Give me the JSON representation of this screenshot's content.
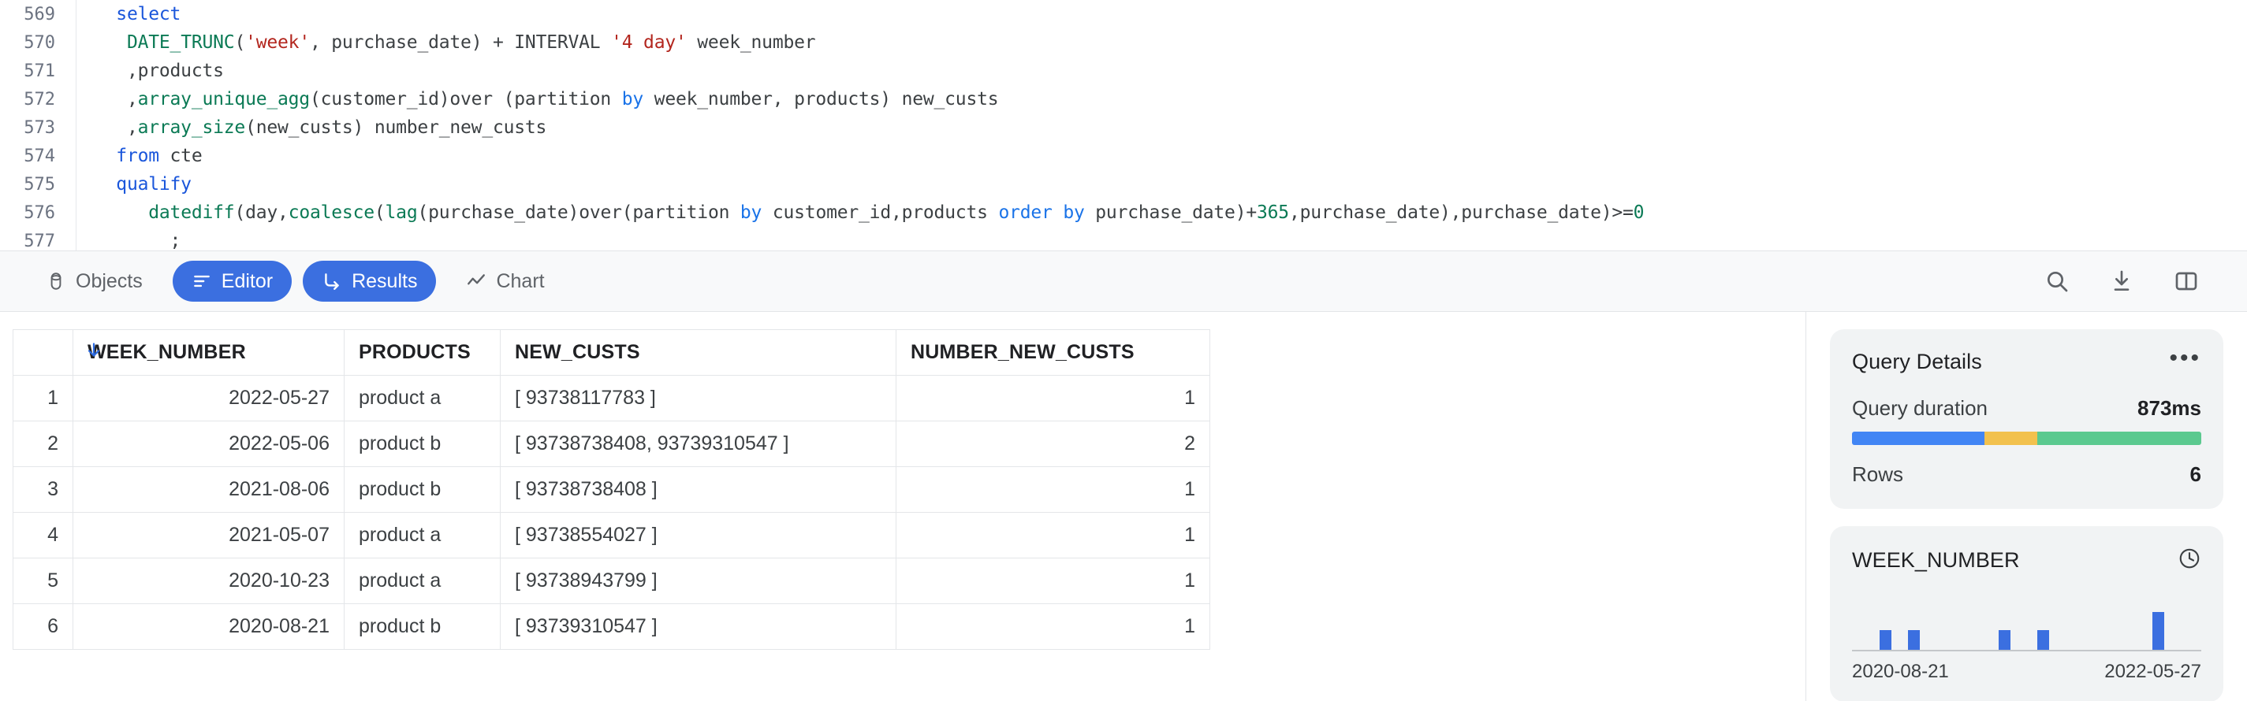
{
  "editor": {
    "lines": [
      {
        "number": "569",
        "tokens": [
          {
            "t": "  ",
            "c": ""
          },
          {
            "t": "select",
            "c": "kw"
          }
        ]
      },
      {
        "number": "570",
        "tokens": [
          {
            "t": "   ",
            "c": ""
          },
          {
            "t": "DATE_TRUNC",
            "c": "fn"
          },
          {
            "t": "(",
            "c": ""
          },
          {
            "t": "'week'",
            "c": "str"
          },
          {
            "t": ", purchase_date) + INTERVAL ",
            "c": ""
          },
          {
            "t": "'4 day'",
            "c": "str"
          },
          {
            "t": " week_number",
            "c": ""
          }
        ]
      },
      {
        "number": "571",
        "tokens": [
          {
            "t": "   ,products",
            "c": ""
          }
        ]
      },
      {
        "number": "572",
        "tokens": [
          {
            "t": "   ,",
            "c": ""
          },
          {
            "t": "array_unique_agg",
            "c": "fn"
          },
          {
            "t": "(customer_id)over (partition ",
            "c": ""
          },
          {
            "t": "by",
            "c": "kw2"
          },
          {
            "t": " week_number, products) new_custs",
            "c": ""
          }
        ]
      },
      {
        "number": "573",
        "tokens": [
          {
            "t": "   ,",
            "c": ""
          },
          {
            "t": "array_size",
            "c": "fn"
          },
          {
            "t": "(new_custs) number_new_custs",
            "c": ""
          }
        ]
      },
      {
        "number": "574",
        "tokens": [
          {
            "t": "  ",
            "c": ""
          },
          {
            "t": "from",
            "c": "kw"
          },
          {
            "t": " cte",
            "c": ""
          }
        ]
      },
      {
        "number": "575",
        "tokens": [
          {
            "t": "  ",
            "c": ""
          },
          {
            "t": "qualify",
            "c": "kw"
          }
        ]
      },
      {
        "number": "576",
        "tokens": [
          {
            "t": "     ",
            "c": ""
          },
          {
            "t": "datediff",
            "c": "fn"
          },
          {
            "t": "(day,",
            "c": ""
          },
          {
            "t": "coalesce",
            "c": "fn"
          },
          {
            "t": "(",
            "c": ""
          },
          {
            "t": "lag",
            "c": "fn"
          },
          {
            "t": "(purchase_date)over(partition ",
            "c": ""
          },
          {
            "t": "by",
            "c": "kw2"
          },
          {
            "t": " customer_id,products ",
            "c": ""
          },
          {
            "t": "order by",
            "c": "kw2"
          },
          {
            "t": " purchase_date)+",
            "c": ""
          },
          {
            "t": "365",
            "c": "num"
          },
          {
            "t": ",purchase_date),purchase_date)>=",
            "c": ""
          },
          {
            "t": "0",
            "c": "num"
          }
        ]
      },
      {
        "number": "577",
        "tokens": [
          {
            "t": "       ;",
            "c": ""
          }
        ]
      }
    ]
  },
  "tabbar": {
    "tabs": [
      {
        "id": "objects",
        "label": "Objects",
        "icon": "database-icon",
        "active": false
      },
      {
        "id": "editor",
        "label": "Editor",
        "icon": "editor-lines-icon",
        "active": true
      },
      {
        "id": "results",
        "label": "Results",
        "icon": "results-arrow-icon",
        "active": true
      },
      {
        "id": "chart",
        "label": "Chart",
        "icon": "chart-line-icon",
        "active": false
      }
    ],
    "tools": [
      {
        "id": "search",
        "icon": "search-icon"
      },
      {
        "id": "download",
        "icon": "download-icon"
      },
      {
        "id": "split-panel",
        "icon": "split-panel-icon"
      }
    ],
    "active_color": "#3b6fe0"
  },
  "results": {
    "sort_column": "WEEK_NUMBER",
    "sort_direction": "desc",
    "columns": [
      "",
      "WEEK_NUMBER",
      "PRODUCTS",
      "NEW_CUSTS",
      "NUMBER_NEW_CUSTS"
    ],
    "rows": [
      {
        "idx": "1",
        "week_number": "2022-05-27",
        "products": "product a",
        "new_custs": "[ 93738117783 ]",
        "number_new_custs": "1"
      },
      {
        "idx": "2",
        "week_number": "2022-05-06",
        "products": "product b",
        "new_custs": "[ 93738738408,  93739310547 ]",
        "number_new_custs": "2"
      },
      {
        "idx": "3",
        "week_number": "2021-08-06",
        "products": "product b",
        "new_custs": "[ 93738738408 ]",
        "number_new_custs": "1"
      },
      {
        "idx": "4",
        "week_number": "2021-05-07",
        "products": "product a",
        "new_custs": "[ 93738554027 ]",
        "number_new_custs": "1"
      },
      {
        "idx": "5",
        "week_number": "2020-10-23",
        "products": "product a",
        "new_custs": "[ 93738943799 ]",
        "number_new_custs": "1"
      },
      {
        "idx": "6",
        "week_number": "2020-08-21",
        "products": "product b",
        "new_custs": "[ 93739310547 ]",
        "number_new_custs": "1"
      }
    ]
  },
  "sidebar": {
    "query_details": {
      "title": "Query Details",
      "menu_icon": "more-options-icon",
      "duration_label": "Query duration",
      "duration_value": "873ms",
      "duration_segments": [
        {
          "name": "compilation",
          "pct": 38,
          "color": "#4285f4"
        },
        {
          "name": "queued",
          "pct": 15,
          "color": "#f2c14e"
        },
        {
          "name": "execution",
          "pct": 47,
          "color": "#5bc98f"
        }
      ],
      "rows_label": "Rows",
      "rows_value": "6"
    },
    "histogram": {
      "title": "WEEK_NUMBER",
      "type_icon": "clock-icon",
      "min_label": "2020-08-21",
      "max_label": "2022-05-27"
    }
  },
  "chart_data": {
    "type": "bar",
    "title": "WEEK_NUMBER",
    "xlabel": "",
    "ylabel": "",
    "grid": false,
    "legend": "none",
    "categories": [
      "2020-08-21",
      "2020-10-23",
      "2021-05-07",
      "2021-08-06",
      "2022-05-06",
      "2022-05-27"
    ],
    "values": [
      1,
      1,
      1,
      1,
      1,
      2
    ],
    "xlim": [
      "2020-08-21",
      "2022-05-27"
    ],
    "bars": [
      {
        "x_pct": 8,
        "height_pct": 52
      },
      {
        "x_pct": 16,
        "height_pct": 52
      },
      {
        "x_pct": 42,
        "height_pct": 52
      },
      {
        "x_pct": 53,
        "height_pct": 52
      },
      {
        "x_pct": 86,
        "height_pct": 100
      }
    ]
  }
}
